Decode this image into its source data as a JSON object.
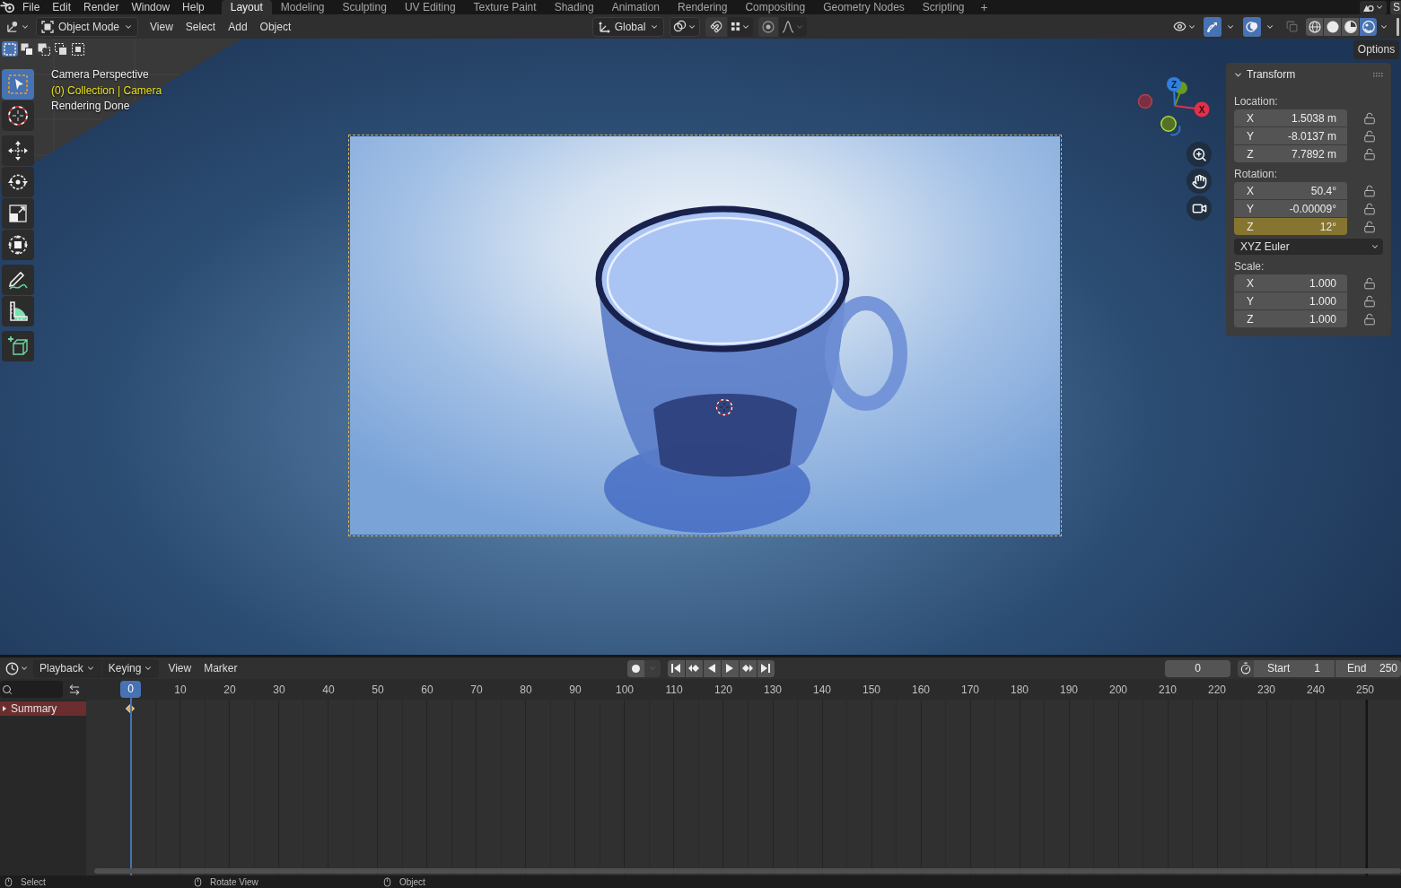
{
  "top_bar": {
    "menus": [
      "File",
      "Edit",
      "Render",
      "Window",
      "Help"
    ],
    "workspaces": [
      {
        "label": "Layout",
        "selected": true
      },
      {
        "label": "Modeling",
        "selected": false
      },
      {
        "label": "Sculpting",
        "selected": false
      },
      {
        "label": "UV Editing",
        "selected": false
      },
      {
        "label": "Texture Paint",
        "selected": false
      },
      {
        "label": "Shading",
        "selected": false
      },
      {
        "label": "Animation",
        "selected": false
      },
      {
        "label": "Rendering",
        "selected": false
      },
      {
        "label": "Compositing",
        "selected": false
      },
      {
        "label": "Geometry Nodes",
        "selected": false
      },
      {
        "label": "Scripting",
        "selected": false
      }
    ],
    "add_workspace": "+",
    "scene": "S"
  },
  "viewport_header": {
    "mode": "Object Mode",
    "menus": [
      "View",
      "Select",
      "Add",
      "Object"
    ],
    "orientation": "Global",
    "gizmos_on": true,
    "overlays_on": true,
    "xray_on": false,
    "shading_modes": [
      {
        "kind": "wireframe",
        "selected": false
      },
      {
        "kind": "solid",
        "selected": false
      },
      {
        "kind": "material",
        "selected": false
      },
      {
        "kind": "rendered",
        "selected": true
      }
    ]
  },
  "select_modes": [
    {
      "kind": "set",
      "selected": true
    },
    {
      "kind": "extend",
      "selected": false
    },
    {
      "kind": "subtract",
      "selected": false
    },
    {
      "kind": "invert",
      "selected": false
    },
    {
      "kind": "intersect",
      "selected": false
    }
  ],
  "tool_groups": [
    [
      {
        "kind": "select-box",
        "selected": true
      },
      {
        "kind": "cursor",
        "selected": false
      }
    ],
    [
      {
        "kind": "move",
        "selected": false
      },
      {
        "kind": "rotate",
        "selected": false
      },
      {
        "kind": "scale",
        "selected": false
      },
      {
        "kind": "transform",
        "selected": false
      }
    ],
    [
      {
        "kind": "annotate",
        "selected": false
      },
      {
        "kind": "measure",
        "selected": false
      }
    ],
    [
      {
        "kind": "add-cube",
        "selected": false
      }
    ]
  ],
  "overlay_text": {
    "view": "Camera Perspective",
    "object": "(0) Collection | Camera",
    "status": "Rendering Done"
  },
  "gizmo": {
    "z_label": "Z",
    "x_label": "X"
  },
  "sidebar": {
    "tab": "Options",
    "panel": {
      "title": "Transform",
      "expanded": true,
      "groups": [
        {
          "label": "Location:",
          "fields": [
            {
              "axis": "X",
              "value": "1.5038 m",
              "keyed": false
            },
            {
              "axis": "Y",
              "value": "-8.0137 m",
              "keyed": false
            },
            {
              "axis": "Z",
              "value": "7.7892 m",
              "keyed": false
            }
          ]
        },
        {
          "label": "Rotation:",
          "fields": [
            {
              "axis": "X",
              "value": "50.4°",
              "keyed": false
            },
            {
              "axis": "Y",
              "value": "-0.00009°",
              "keyed": false
            },
            {
              "axis": "Z",
              "value": "12°",
              "keyed": true
            }
          ],
          "mode": "XYZ Euler"
        },
        {
          "label": "Scale:",
          "fields": [
            {
              "axis": "X",
              "value": "1.000",
              "keyed": false
            },
            {
              "axis": "Y",
              "value": "1.000",
              "keyed": false
            },
            {
              "axis": "Z",
              "value": "1.000",
              "keyed": false
            }
          ]
        }
      ]
    }
  },
  "timeline": {
    "dropdowns": [
      "Playback",
      "Keying"
    ],
    "menus": [
      "View",
      "Marker"
    ],
    "current_frame": "0",
    "start": {
      "label": "Start",
      "value": "1"
    },
    "end": {
      "label": "End",
      "value": "250"
    },
    "playhead": "0",
    "ruler": [
      "10",
      "20",
      "30",
      "40",
      "50",
      "60",
      "70",
      "80",
      "90",
      "100",
      "110",
      "120",
      "130",
      "140",
      "150",
      "160",
      "170",
      "180",
      "190",
      "200",
      "210",
      "220",
      "230",
      "240",
      "250"
    ],
    "channels": [
      {
        "label": "Summary",
        "expanded": false
      }
    ]
  },
  "status_bar": [
    "Select",
    "Rotate View",
    "Object"
  ]
}
